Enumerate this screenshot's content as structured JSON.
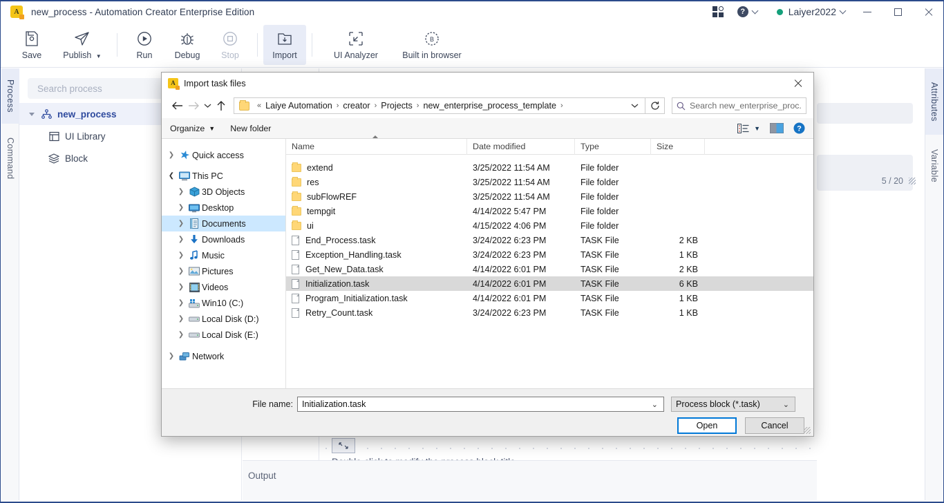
{
  "app": {
    "icon": "automation-creator-logo",
    "title": "new_process - Automation Creator Enterprise Edition",
    "titlebar": {
      "apps_icon": "apps-grid-icon",
      "help_icon": "help-circle-icon",
      "user": "Laiyer2022",
      "status": "online",
      "minimize": "minimize-icon",
      "maximize": "maximize-icon",
      "close": "close-icon"
    },
    "toolbar": [
      {
        "label": "Save",
        "icon": "save-icon",
        "state": "normal"
      },
      {
        "label": "Publish",
        "icon": "publish-icon",
        "state": "normal",
        "dropdown": true
      },
      {
        "label": "Run",
        "icon": "run-icon",
        "state": "normal"
      },
      {
        "label": "Debug",
        "icon": "debug-icon",
        "state": "normal"
      },
      {
        "label": "Stop",
        "icon": "stop-icon",
        "state": "disabled"
      },
      {
        "label": "Import",
        "icon": "import-icon",
        "state": "active"
      },
      {
        "label": "UI Analyzer",
        "icon": "ui-analyzer-icon",
        "state": "normal"
      },
      {
        "label": "Built in browser",
        "icon": "built-in-browser-icon",
        "state": "normal"
      }
    ],
    "left_rail": [
      {
        "label": "Process",
        "selected": true
      },
      {
        "label": "Command",
        "selected": false
      }
    ],
    "right_rail": [
      {
        "label": "Attributes",
        "selected": true
      },
      {
        "label": "Variable",
        "selected": false
      }
    ],
    "process_panel": {
      "search_placeholder": "Search process",
      "tree": [
        {
          "label": "new_process",
          "icon": "process-tree-icon",
          "level": 0,
          "expanded": true,
          "selected": true
        },
        {
          "label": "UI Library",
          "icon": "ui-library-icon",
          "level": 1
        },
        {
          "label": "Block",
          "icon": "block-layers-icon",
          "level": 1
        }
      ]
    },
    "canvas": {
      "hint": "Double-click to modify the process block title",
      "block_handle_icon": "resize-handle-icon"
    },
    "output": {
      "label": "Output"
    },
    "right_panel": {
      "counter": "5 / 20",
      "resize_icon": "resize-grip-icon"
    }
  },
  "dialog": {
    "icon": "automation-creator-logo",
    "title": "Import task files",
    "close_icon": "close-icon",
    "nav": {
      "back_icon": "arrow-left-icon",
      "forward_icon": "arrow-right-icon",
      "recent_icon": "chevron-down-icon",
      "up_icon": "arrow-up-icon",
      "refresh_icon": "refresh-icon",
      "breadcrumb_folder_icon": "folder-icon",
      "breadcrumb_overflow": "«",
      "breadcrumb": [
        "Laiye Automation",
        "creator",
        "Projects",
        "new_enterprise_process_template"
      ],
      "breadcrumb_dropdown_icon": "chevron-down-icon",
      "search_icon": "search-icon",
      "search_placeholder": "Search new_enterprise_proc..."
    },
    "commandbar": {
      "organize": "Organize",
      "new_folder": "New folder",
      "view_icon": "view-list-icon",
      "view_dropdown_icon": "chevron-down-icon",
      "preview_pane_icon": "preview-pane-icon",
      "help_icon": "help-circle-icon"
    },
    "nav_pane": [
      {
        "label": "Quick access",
        "icon": "star-icon",
        "level": 0,
        "expanded": false,
        "selected": false
      },
      {
        "label": "This PC",
        "icon": "computer-icon",
        "level": 0,
        "expanded": true,
        "selected": false
      },
      {
        "label": "3D Objects",
        "icon": "3d-objects-icon",
        "level": 1,
        "expanded": false,
        "selected": false
      },
      {
        "label": "Desktop",
        "icon": "desktop-icon",
        "level": 1,
        "expanded": false,
        "selected": false
      },
      {
        "label": "Documents",
        "icon": "documents-icon",
        "level": 1,
        "expanded": false,
        "selected": true
      },
      {
        "label": "Downloads",
        "icon": "downloads-icon",
        "level": 1,
        "expanded": false,
        "selected": false
      },
      {
        "label": "Music",
        "icon": "music-icon",
        "level": 1,
        "expanded": false,
        "selected": false
      },
      {
        "label": "Pictures",
        "icon": "pictures-icon",
        "level": 1,
        "expanded": false,
        "selected": false
      },
      {
        "label": "Videos",
        "icon": "videos-icon",
        "level": 1,
        "expanded": false,
        "selected": false
      },
      {
        "label": "Win10 (C:)",
        "icon": "windows-drive-icon",
        "level": 1,
        "expanded": false,
        "selected": false
      },
      {
        "label": "Local Disk (D:)",
        "icon": "drive-icon",
        "level": 1,
        "expanded": false,
        "selected": false
      },
      {
        "label": "Local Disk (E:)",
        "icon": "drive-icon",
        "level": 1,
        "expanded": false,
        "selected": false
      },
      {
        "label": "Network",
        "icon": "network-icon",
        "level": 0,
        "expanded": false,
        "selected": false
      }
    ],
    "columns": [
      {
        "key": "name",
        "label": "Name",
        "sorted": "asc"
      },
      {
        "key": "date",
        "label": "Date modified"
      },
      {
        "key": "type",
        "label": "Type"
      },
      {
        "key": "size",
        "label": "Size"
      }
    ],
    "files": [
      {
        "name": "extend",
        "date": "3/25/2022 11:54 AM",
        "type": "File folder",
        "size": "",
        "kind": "folder",
        "selected": false
      },
      {
        "name": "res",
        "date": "3/25/2022 11:54 AM",
        "type": "File folder",
        "size": "",
        "kind": "folder",
        "selected": false
      },
      {
        "name": "subFlowREF",
        "date": "3/25/2022 11:54 AM",
        "type": "File folder",
        "size": "",
        "kind": "folder",
        "selected": false
      },
      {
        "name": "tempgit",
        "date": "4/14/2022 5:47 PM",
        "type": "File folder",
        "size": "",
        "kind": "folder",
        "selected": false
      },
      {
        "name": "ui",
        "date": "4/15/2022 4:06 PM",
        "type": "File folder",
        "size": "",
        "kind": "folder",
        "selected": false
      },
      {
        "name": "End_Process.task",
        "date": "3/24/2022 6:23 PM",
        "type": "TASK File",
        "size": "2 KB",
        "kind": "file",
        "selected": false
      },
      {
        "name": "Exception_Handling.task",
        "date": "3/24/2022 6:23 PM",
        "type": "TASK File",
        "size": "1 KB",
        "kind": "file",
        "selected": false
      },
      {
        "name": "Get_New_Data.task",
        "date": "4/14/2022 6:01 PM",
        "type": "TASK File",
        "size": "2 KB",
        "kind": "file",
        "selected": false
      },
      {
        "name": "Initialization.task",
        "date": "4/14/2022 6:01 PM",
        "type": "TASK File",
        "size": "6 KB",
        "kind": "file",
        "selected": true
      },
      {
        "name": "Program_Initialization.task",
        "date": "4/14/2022 6:01 PM",
        "type": "TASK File",
        "size": "1 KB",
        "kind": "file",
        "selected": false
      },
      {
        "name": "Retry_Count.task",
        "date": "3/24/2022 6:23 PM",
        "type": "TASK File",
        "size": "1 KB",
        "kind": "file",
        "selected": false
      }
    ],
    "footer": {
      "filename_label": "File name:",
      "filename_value": "Initialization.task",
      "filename_dropdown_icon": "chevron-down-icon",
      "filter_value": "Process block (*.task)",
      "filter_dropdown_icon": "chevron-down-icon",
      "open_button": "Open",
      "cancel_button": "Cancel",
      "resize_grip_icon": "resize-grip-icon"
    }
  },
  "colors": {
    "accent_blue": "#2e4a9e",
    "window_border": "#2b4a8b",
    "selection_blue": "#cce8ff",
    "row_selection_gray": "#d9d9d9",
    "primary_button_border": "#0078d7",
    "status_green": "#14a07b",
    "folder_yellow": "#ffd777"
  }
}
